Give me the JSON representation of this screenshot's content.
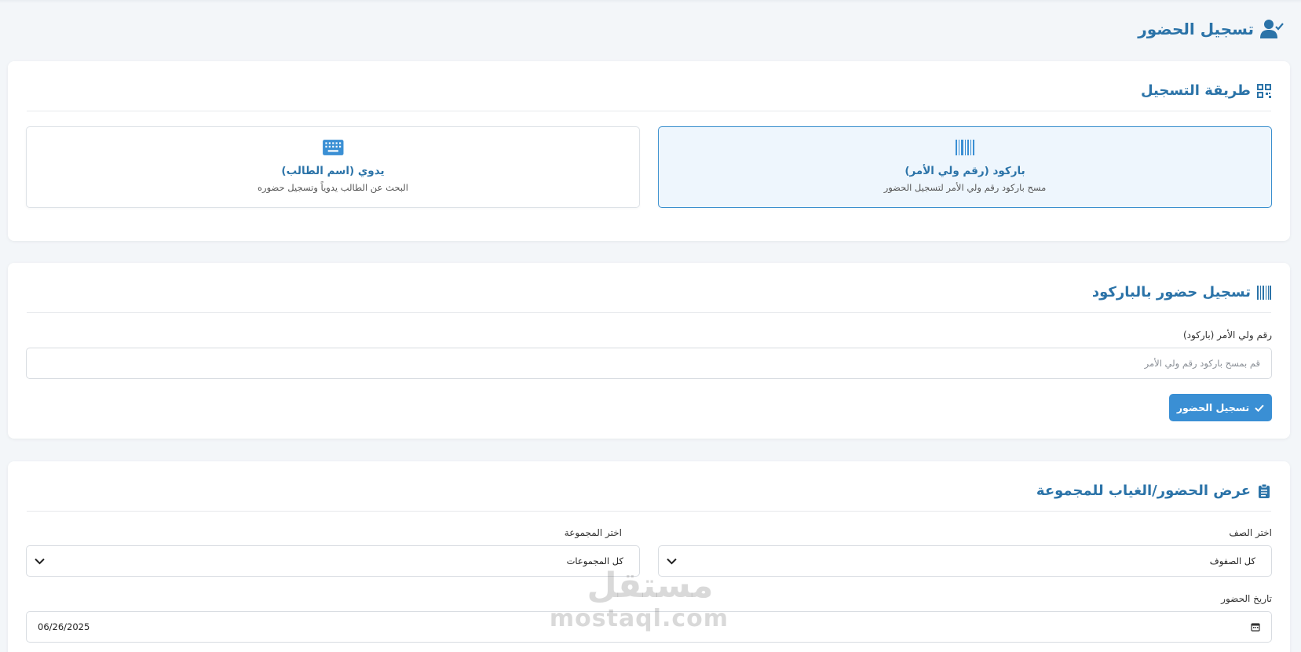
{
  "page": {
    "title": "تسجيل الحضور"
  },
  "method_card": {
    "title": "طريقة التسجيل",
    "options": [
      {
        "id": "barcode",
        "title": "باركود (رقم ولي الأمر)",
        "desc": "مسح باركود رقم ولي الأمر لتسجيل الحضور",
        "active": true
      },
      {
        "id": "manual",
        "title": "يدوي (اسم الطالب)",
        "desc": "البحث عن الطالب يدوياً وتسجيل حضوره",
        "active": false
      }
    ]
  },
  "barcode_card": {
    "title": "تسجيل حضور بالباركود",
    "field_label": "رقم ولي الأمر (باركود)",
    "placeholder": "قم بمسح باركود رقم ولي الأمر",
    "value": "",
    "submit_label": "تسجيل الحضور"
  },
  "view_card": {
    "title": "عرض الحضور/الغياب للمجموعة",
    "class_label": "اختر الصف",
    "class_value": "كل الصفوف",
    "group_label": "اختر المجموعة",
    "group_value": "كل المجموعات",
    "date_label": "تاريخ الحضور",
    "date_value": "06/26/2025"
  },
  "watermark": {
    "ar": "مستقل",
    "en": "mostaql.com"
  },
  "colors": {
    "accent": "#2b73a8",
    "button": "#3a8fd4",
    "active_bg": "#eef6fd",
    "active_border": "#3a8fce"
  },
  "icons": {
    "page_title": "user-check-icon",
    "method": "qrcode-icon",
    "barcode": "barcode-icon",
    "manual": "keyboard-icon",
    "view": "clipboard-list-icon",
    "submit": "check-icon",
    "select": "chevron-down-icon",
    "date": "calendar-icon"
  }
}
